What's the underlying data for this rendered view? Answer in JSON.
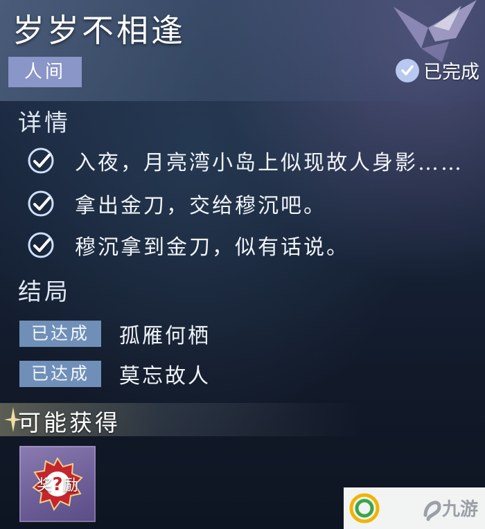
{
  "quest": {
    "title": "岁岁不相逢",
    "category": "人间",
    "status": "已完成"
  },
  "details": {
    "heading": "详情",
    "items": [
      {
        "text": "入夜，月亮湾小岛上似现故人身影……",
        "checked": true
      },
      {
        "text": "拿出金刀，交给穆沉吧。",
        "checked": true
      },
      {
        "text": "穆沉拿到金刀，似有话说。",
        "checked": true
      }
    ]
  },
  "endings": {
    "heading": "结局",
    "items": [
      {
        "badge": "已达成",
        "name": "孤雁何栖"
      },
      {
        "badge": "已达成",
        "name": "莫忘故人"
      }
    ]
  },
  "rewards": {
    "heading": "可能获得",
    "items": [
      {
        "label": "奖励",
        "icon": "question-mark-icon"
      }
    ]
  },
  "watermark": {
    "brand": "九游"
  },
  "colors": {
    "tag_bg": "#8a95c8",
    "ending_badge_bg": "#6f8fb8",
    "check_color": "#cfe0ff",
    "reward_card_bg": "#7a6aa6",
    "reward_accent": "#c0282e"
  }
}
